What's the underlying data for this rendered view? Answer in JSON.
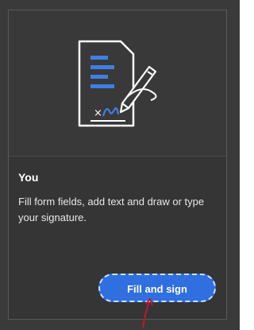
{
  "card": {
    "title": "You",
    "description": "Fill form fields, add text and draw or type your signature.",
    "button_label": "Fill and sign"
  },
  "illustration": {
    "icon": "document-signature-icon",
    "signature_mark": "× li"
  },
  "colors": {
    "panel_bg": "#3a3a3a",
    "card_bg": "#353535",
    "accent_blue": "#2f6fe0",
    "icon_blue": "#3f7fe6",
    "annotation_red": "#c0182a"
  }
}
